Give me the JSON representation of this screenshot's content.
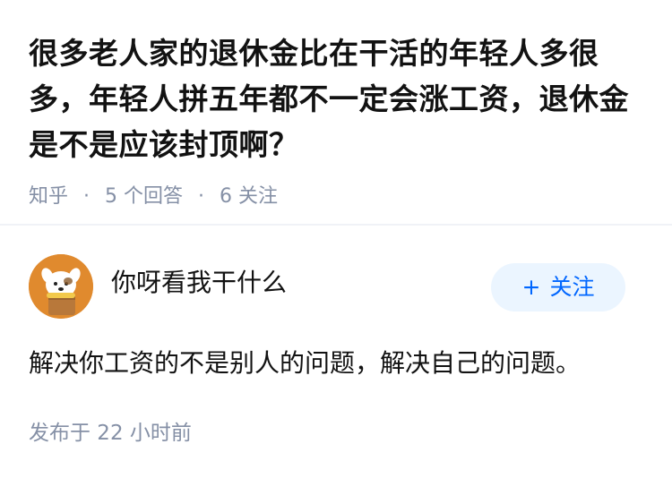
{
  "question": {
    "title": "很多老人家的退休金比在干活的年轻人多很多，年轻人拼五年都不一定会涨工资，退休金是不是应该封顶啊？",
    "source": "知乎",
    "answer_count_label": "5 个回答",
    "follower_count_label": "6 关注"
  },
  "answer": {
    "author_name": "你呀看我干什么",
    "follow_plus": "+",
    "follow_label": "关注",
    "content": "解决你工资的不是别人的问题，解决自己的问题。",
    "published": "发布于  22 小时前"
  },
  "colors": {
    "accent": "#0066ff",
    "follow_bg": "#ebf5ff",
    "meta_text": "#8590a6",
    "avatar_bg": "#e08a2e"
  }
}
